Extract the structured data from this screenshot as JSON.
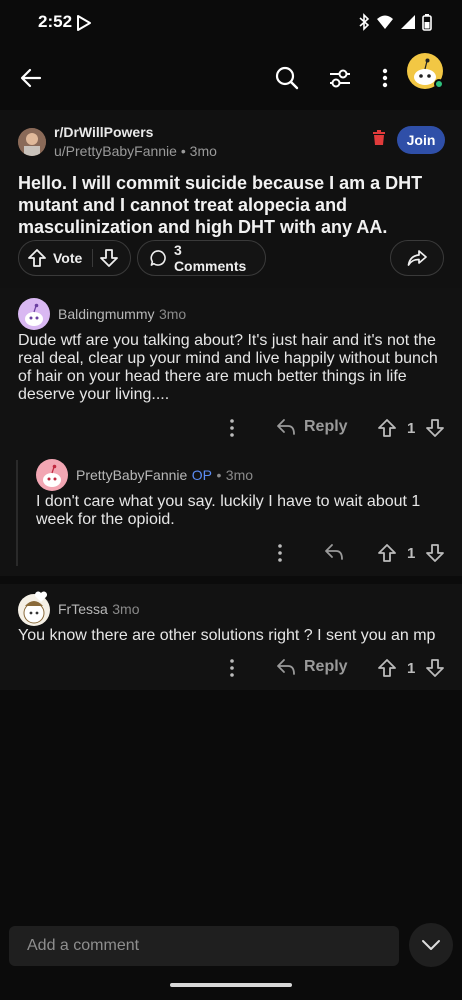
{
  "status_bar": {
    "time": "2:52"
  },
  "post": {
    "subreddit": "r/DrWillPowers",
    "author": "u/PrettyBabyFannie",
    "age": "3mo",
    "join_label": "Join",
    "title": "Hello. I will commit suicide because I am a DHT mutant and I cannot treat alopecia and masculinization and high DHT with any AA.",
    "vote_label": "Vote",
    "comments_label": "3 Comments"
  },
  "comments": [
    {
      "author": "Baldingmummy",
      "time": "3mo",
      "body": "Dude wtf are you talking about? It's just hair and it's not the real deal,  clear up your mind and live happily without bunch of hair on your head there are much better things in life deserve your living....",
      "reply_label": "Reply",
      "score": "1"
    },
    {
      "author": "PrettyBabyFannie",
      "op_badge": "OP",
      "time": "3mo",
      "body": "I don't care what you say. luckily I have to wait about 1 week for the opioid.",
      "score": "1"
    },
    {
      "author": "FrTessa",
      "time": "3mo",
      "body": "You know there are other solutions right ? I sent you an mp",
      "reply_label": "Reply",
      "score": "1"
    }
  ],
  "composer": {
    "placeholder": "Add a comment"
  },
  "colors": {
    "join": "#2f4fa8",
    "op": "#5b8cf5",
    "online": "#2ec27e",
    "avatar_me": "#f2c744"
  }
}
